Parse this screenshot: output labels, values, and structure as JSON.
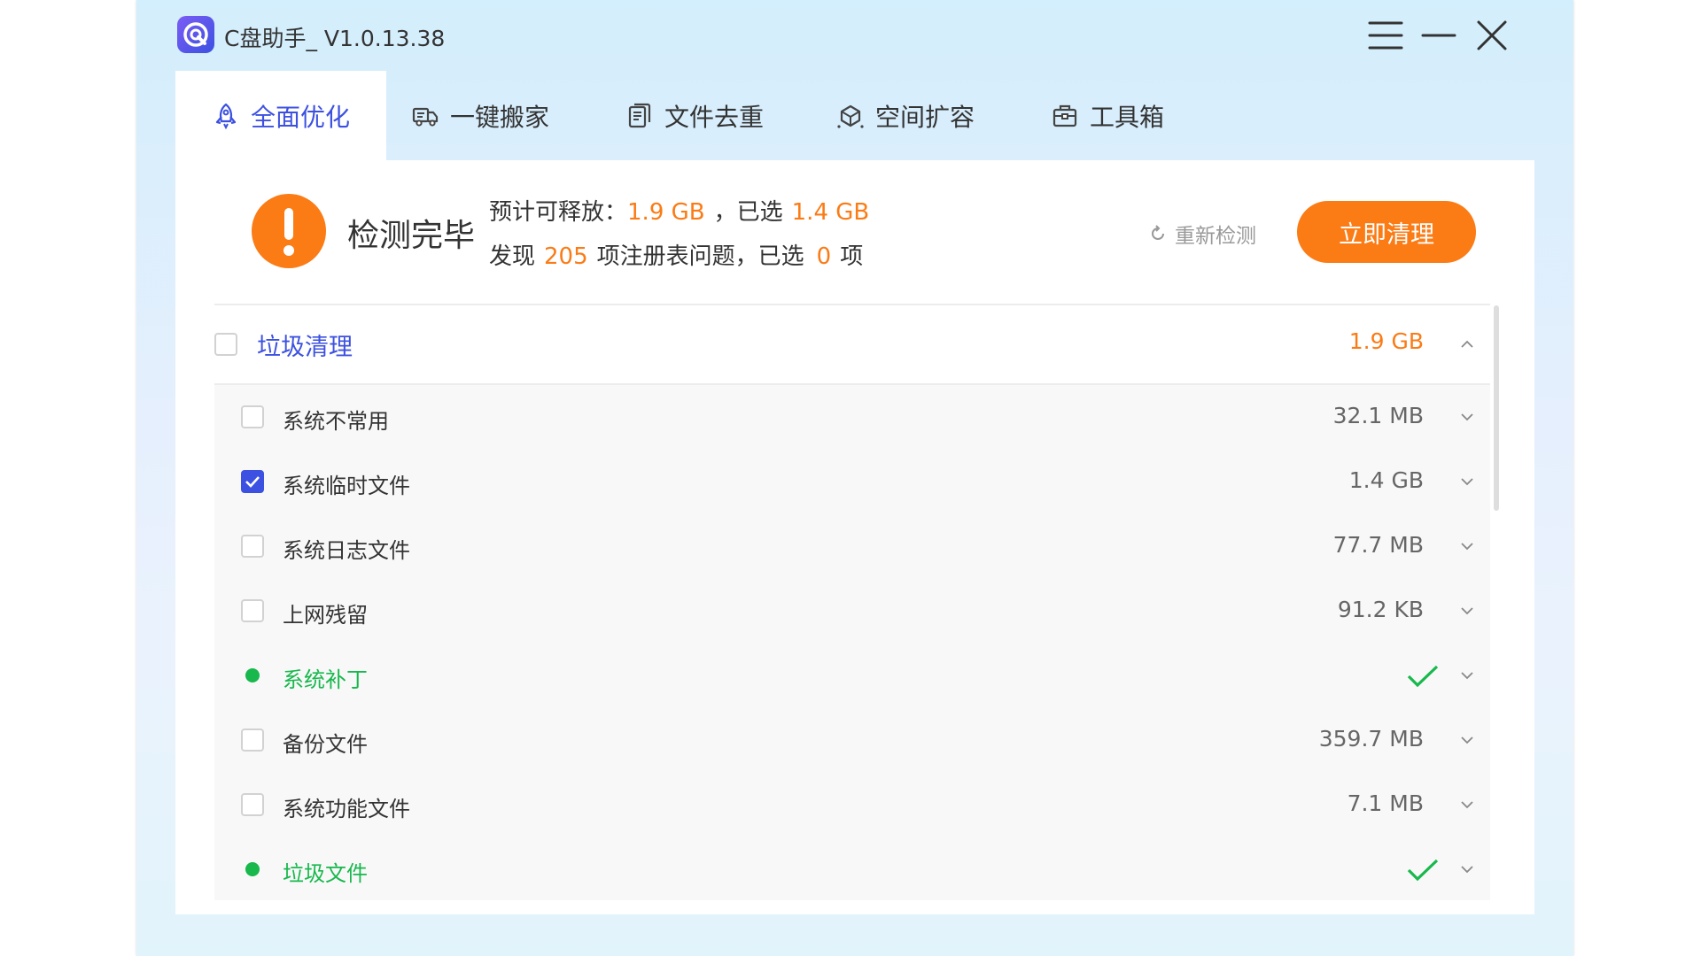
{
  "window": {
    "title": "C盘助手_ V1.0.13.38",
    "controls": [
      "menu-icon",
      "minimize-icon",
      "close-icon"
    ]
  },
  "tabs": [
    {
      "label": "全面优化",
      "icon": "rocket-icon",
      "active": true
    },
    {
      "label": "一键搬家",
      "icon": "truck-icon",
      "active": false
    },
    {
      "label": "文件去重",
      "icon": "document-icon",
      "active": false
    },
    {
      "label": "空间扩容",
      "icon": "expand-icon",
      "active": false
    },
    {
      "label": "工具箱",
      "icon": "toolbox-icon",
      "active": false
    }
  ],
  "summary": {
    "status_title": "检测完毕",
    "line1_prefix": "预计可释放：",
    "releasable": "1.9 GB",
    "line1_mid": "，已选",
    "selected_size": "1.4 GB",
    "line2_prefix": "发现",
    "issues_count": "205",
    "line2_mid": "项注册表问题，已选",
    "selected_count": "0",
    "line2_suffix": "项",
    "rescan_label": "重新检测",
    "clean_label": "立即清理"
  },
  "category": {
    "label": "垃圾清理",
    "size": "1.9 GB",
    "expanded": true,
    "checked": false
  },
  "items": [
    {
      "label": "系统不常用",
      "size": "32.1 MB",
      "state": "unchecked"
    },
    {
      "label": "系统临时文件",
      "size": "1.4 GB",
      "state": "checked"
    },
    {
      "label": "系统日志文件",
      "size": "77.7 MB",
      "state": "unchecked"
    },
    {
      "label": "上网残留",
      "size": "91.2 KB",
      "state": "unchecked"
    },
    {
      "label": "系统补丁",
      "size": "",
      "state": "clean"
    },
    {
      "label": "备份文件",
      "size": "359.7 MB",
      "state": "unchecked"
    },
    {
      "label": "系统功能文件",
      "size": "7.1 MB",
      "state": "unchecked"
    },
    {
      "label": "垃圾文件",
      "size": "",
      "state": "clean"
    }
  ],
  "colors": {
    "accent_blue": "#3c51e1",
    "accent_orange": "#fb7b15",
    "success_green": "#18b84d"
  }
}
